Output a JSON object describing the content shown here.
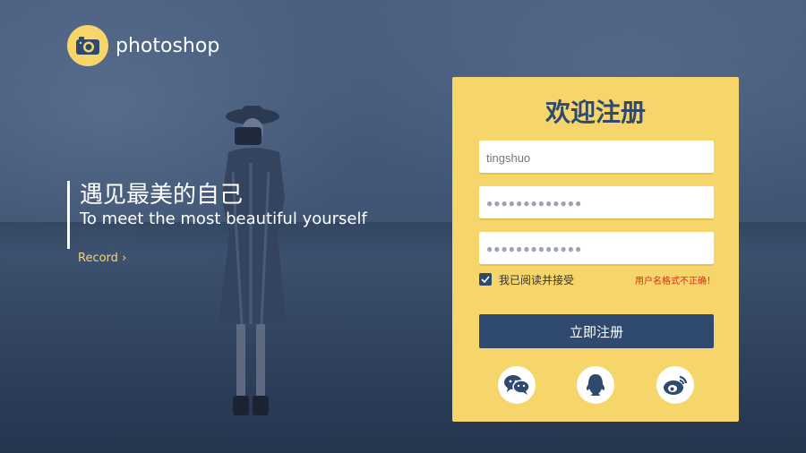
{
  "brand": {
    "name": "photoshop",
    "icon": "camera-icon"
  },
  "hero": {
    "title_cn": "遇见最美的自己",
    "title_en": "To meet the most beautiful yourself",
    "link_label": "Record",
    "link_chevron": "›"
  },
  "form": {
    "title": "欢迎注册",
    "username": {
      "value": "tingshuo"
    },
    "password": {
      "value": "●●●●●●●●●●●●●"
    },
    "confirm_password": {
      "value": "●●●●●●●●●●●●●"
    },
    "agree": {
      "label": "我已阅读并接受",
      "checked": true
    },
    "error": "用户名格式不正确！",
    "submit_label": "立即注册",
    "social": [
      {
        "icon": "wechat-icon"
      },
      {
        "icon": "qq-icon"
      },
      {
        "icon": "weibo-icon"
      }
    ]
  },
  "colors": {
    "accent": "#f6d56a",
    "primary": "#2f4a6e",
    "error": "#e02a1a"
  }
}
